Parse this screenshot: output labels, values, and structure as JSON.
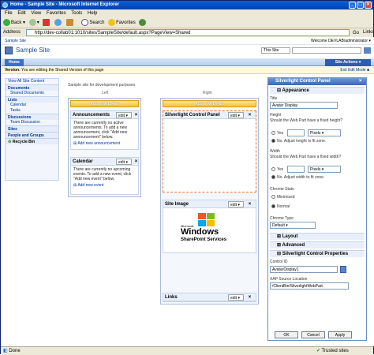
{
  "window": {
    "title": "Home - Sample Site - Microsoft Internet Explorer"
  },
  "menu": [
    "File",
    "Edit",
    "View",
    "Favorites",
    "Tools",
    "Help"
  ],
  "toolbar": {
    "back": "Back",
    "search": "Search",
    "favorites": "Favorites"
  },
  "address": {
    "label": "Address",
    "url": "http://dev-collab01:1010/sites/SampleSite/default.aspx?PageView=Shared",
    "go": "Go",
    "links": "Links"
  },
  "site": {
    "breadcrumb": "Sample Site",
    "welcome": "Welcome DEVLAB\\administrator ▾",
    "title": "Sample Site",
    "scope": "This Site",
    "home_tab": "Home",
    "site_actions": "Site Actions ▾",
    "version_label": "Version:",
    "version_text": "You are editing the Shared Version of this page",
    "exit_edit": "Exit Edit Mode ■"
  },
  "quicklaunch": {
    "view_all": "View All Site Content",
    "documents": "Documents",
    "shared_docs": "Shared Documents",
    "lists": "Lists",
    "calendar": "Calendar",
    "tasks": "Tasks",
    "discussions": "Discussions",
    "team_discussion": "Team Discussion",
    "sites": "Sites",
    "people": "People and Groups",
    "recycle": "Recycle Bin"
  },
  "zones": {
    "description": "Sample site for development purposes",
    "left": "Left",
    "right": "Right",
    "add_web_part": "Add a Web Part"
  },
  "webparts": {
    "announcements": {
      "title": "Announcements",
      "body": "There are currently no active announcements. To add a new announcement, click \"Add new announcement\" below.",
      "link": "Add new announcement"
    },
    "calendar": {
      "title": "Calendar",
      "body": "There are currently no upcoming events. To add a new event, click \"Add new event\" below.",
      "link": "Add new event"
    },
    "silverlight": {
      "title": "Silverlight Control Panel"
    },
    "site_image": {
      "title": "Site Image",
      "logo_ms": "Microsoft",
      "logo_windows": "Windows",
      "logo_sp": "SharePoint Services"
    },
    "links": {
      "title": "Links"
    },
    "edit": "edit ▾",
    "close": "×"
  },
  "toolpane": {
    "header": "Silverlight Control Panel",
    "appearance": "Appearance",
    "title_label": "Title",
    "title_value": "Avatar Display",
    "height_label": "Height",
    "height_q": "Should the Web Part have a fixed height?",
    "yes": "Yes",
    "pixels": "Pixels",
    "no_height": "No. Adjust height to fit zone.",
    "width_label": "Width",
    "width_q": "Should the Web Part have a fixed width?",
    "no_width": "No. Adjust width to fit zone.",
    "chrome_state": "Chrome State",
    "minimized": "Minimized",
    "normal": "Normal",
    "chrome_type": "Chrome Type",
    "chrome_type_value": "Default",
    "layout": "Layout",
    "advanced": "Advanced",
    "props": "Silverlight Control Properties",
    "control_id_label": "Control ID",
    "control_id_value": "AvatarDisplay1",
    "xap_label": "XAP Source Location",
    "xap_value": "/ClientBin/SilverlightWebPart.",
    "ok": "OK",
    "cancel": "Cancel",
    "apply": "Apply"
  },
  "status": {
    "done": "Done",
    "zone": "Trusted sites"
  }
}
